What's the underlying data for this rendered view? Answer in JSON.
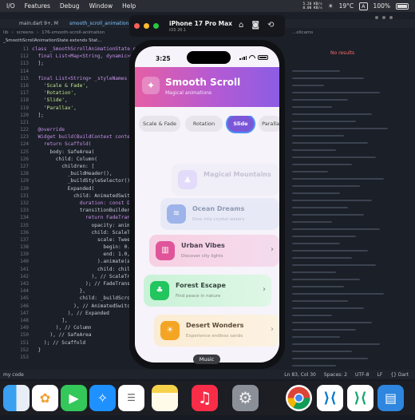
{
  "menubar": {
    "items": [
      "I/O",
      "Features",
      "Debug",
      "Window",
      "Help"
    ],
    "net_up": "5.20 KB/s",
    "net_down": "0.00 KB/s",
    "weather": "19°C",
    "input_badge": "A",
    "battery": "100%"
  },
  "ide": {
    "tabs": [
      "main.dart 9+, M",
      "smooth_scroll_animation..."
    ],
    "crumbs": [
      "lib",
      "screens",
      "176-smooth-scroll-animation",
      "..."
    ],
    "crumb_class": "_SmoothScrollAnimationState extends Stat...",
    "right_crumb": "...ollcams",
    "no_results": "No results",
    "line_numbers": [
      "11",
      "112",
      "113",
      "114",
      "115",
      "116",
      "117",
      "118",
      "119",
      "120",
      "121",
      "122",
      "123",
      "124",
      "125",
      "126",
      "127",
      "128",
      "129",
      "130",
      "131",
      "132",
      "133",
      "134",
      "135",
      "136",
      "137",
      "138",
      "139",
      "140",
      "141",
      "142",
      "143",
      "144",
      "145",
      "146",
      "147",
      "148",
      "149",
      "150",
      "151",
      "152",
      "153"
    ],
    "code_lines": [
      "class _SmoothScrollAnimationState extends S",
      "  final List<Map<String, dynamic>> _destin",
      "  ];",
      "",
      "  final List<String> _styleNames = [",
      "    'Scale & Fade',",
      "    'Rotation',",
      "    'Slide',",
      "    'Parallax',",
      "  ];",
      "",
      "  @override",
      "  Widget build(BuildContext context) {",
      "    return Scaffold(",
      "      body: SafeArea(",
      "        child: Column(",
      "          children: [",
      "            _buildHeader(),",
      "            _buildStyleSelector(),",
      "            Expanded(",
      "              child: AnimatedSwitcher(",
      "                duration: const Durat",
      "                transitionBuilder: (c",
      "                  return FadeTransitio",
      "                    opacity: animation",
      "                    child: ScaleTrans",
      "                      scale: Tween<dou",
      "                        begin: 0.95,",
      "                        end: 1.0,",
      "                      ).animate(anima",
      "                      child: child,",
      "                    ), // ScaleTransi",
      "                  ); // FadeTransitio",
      "                },",
      "                child: _buildScrollLi",
      "              ), // AnimatedSwitcher",
      "            ), // Expanded",
      "          ],",
      "        ), // Column",
      "      ), // SafeArea",
      "    ); // Scaffold",
      "  }",
      "",
      "  /// Beautiful header with gradient",
      "  Widget _buildHeader() {",
      "    return Container(",
      "      padding: const EdgeInsets.all(2",
      "      decoration: BoxDecoration(",
      "        gradient: LinearGradient(",
      "          colors: [Colors.blue.shade400,"
    ],
    "status_left": "my code",
    "status_right": [
      "Ln 83, Col 30",
      "Spaces: 2",
      "UTF-8",
      "LF",
      "{} Dart"
    ]
  },
  "simulator": {
    "device": "iPhone 17 Pro Max",
    "os": "iOS 26.1",
    "toolbar_icons": [
      "home-icon",
      "screenshot-icon",
      "rotate-icon"
    ]
  },
  "app": {
    "time": "3:25",
    "title": "Smooth Scroll",
    "subtitle": "Magical animations",
    "styles": [
      "Scale & Fade",
      "Rotation",
      "Slide",
      "Paralla"
    ],
    "active_style": "Slide",
    "cards": [
      {
        "title": "Magical Mountains",
        "subtitle": "",
        "icon": "mountain-icon",
        "color": "#c4b5fd"
      },
      {
        "title": "Ocean Dreams",
        "subtitle": "Dive into crystal waters",
        "icon": "waves-icon",
        "color": "#6b8fe0"
      },
      {
        "title": "Urban Vibes",
        "subtitle": "Discover city lights",
        "icon": "city-icon",
        "color": "#e0559a"
      },
      {
        "title": "Forest Escape",
        "subtitle": "Find peace in nature",
        "icon": "tree-icon",
        "color": "#22c55e"
      },
      {
        "title": "Desert Wonders",
        "subtitle": "Experience endless sands",
        "icon": "sun-icon",
        "color": "#f5a524"
      }
    ]
  },
  "home_label": "Music",
  "dock": [
    "finder",
    "photos",
    "facetime",
    "safari",
    "reminders",
    "notes",
    "music",
    "settings",
    "chrome",
    "vscode",
    "vscode-insiders",
    "files"
  ]
}
